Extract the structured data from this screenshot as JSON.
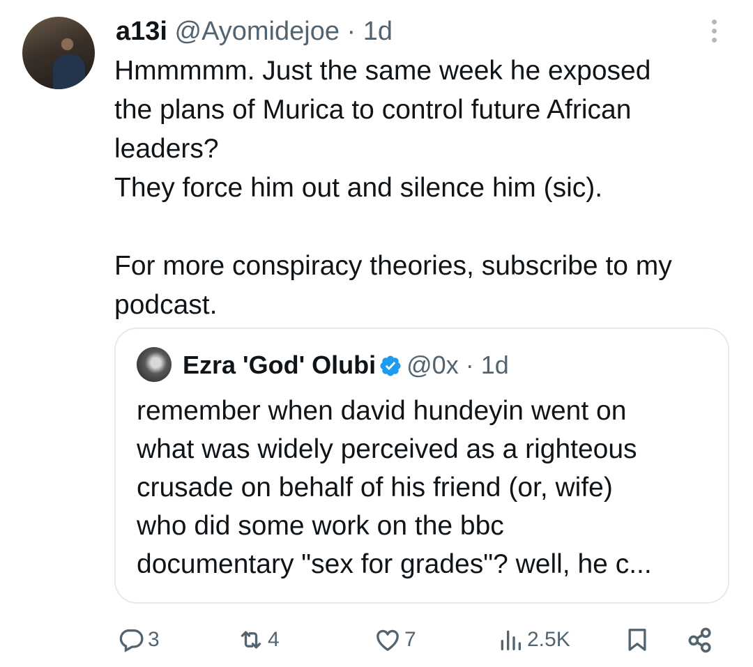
{
  "tweet": {
    "name": "a13i",
    "handle": "@Ayomidejoe",
    "separator": "·",
    "time": "1d",
    "text": "Hmmmmm. Just the same week he exposed\nthe plans of Murica to control future African\nleaders?\nThey force him out and silence him (sic).\n\nFor more conspiracy theories, subscribe to my\npodcast."
  },
  "quote": {
    "name": "Ezra 'God' Olubi",
    "handle": "@0x",
    "separator": "·",
    "time": "1d",
    "text": "remember when david hundeyin went on\nwhat was widely perceived as a righteous\ncrusade on behalf of his friend (or, wife)\nwho did some work on the bbc\ndocumentary \"sex for grades\"? well, he c..."
  },
  "actions": {
    "replies": "3",
    "reposts": "4",
    "likes": "7",
    "views": "2.5K"
  },
  "icons": {
    "more": "more-vertical-icon",
    "verified": "verified-badge-icon",
    "reply": "reply-icon",
    "repost": "repost-icon",
    "like": "heart-icon",
    "views": "views-icon",
    "bookmark": "bookmark-icon",
    "share": "share-icon"
  },
  "colors": {
    "text": "#0f1419",
    "muted": "#536471",
    "verified": "#1d9bf0",
    "border": "#e6eaed"
  }
}
